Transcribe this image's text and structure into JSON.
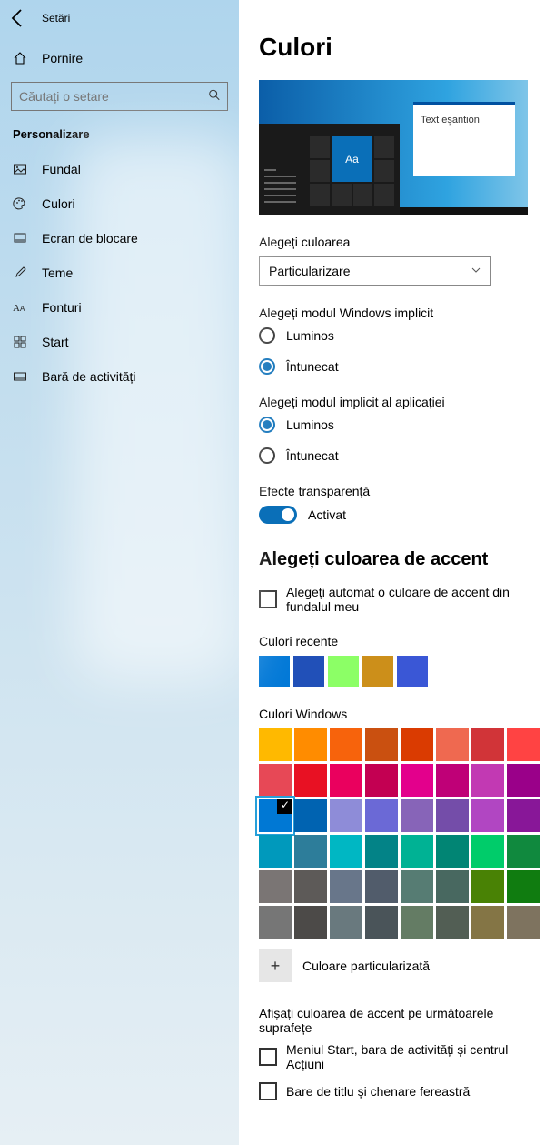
{
  "app_title": "Setări",
  "home_label": "Pornire",
  "search_placeholder": "Căutați o setare",
  "group_label": "Personalizare",
  "nav": [
    {
      "label": "Fundal"
    },
    {
      "label": "Culori"
    },
    {
      "label": "Ecran de blocare"
    },
    {
      "label": "Teme"
    },
    {
      "label": "Fonturi"
    },
    {
      "label": "Start"
    },
    {
      "label": "Bară de activități"
    }
  ],
  "page": {
    "title": "Culori",
    "preview_aa": "Aa",
    "preview_window_text": "Text eșantion",
    "choose_color_label": "Alegeți culoarea",
    "choose_color_value": "Particularizare",
    "windows_mode_label": "Alegeți modul Windows implicit",
    "mode_light": "Luminos",
    "mode_dark": "Întunecat",
    "app_mode_label": "Alegeți modul implicit al aplicației",
    "transparency_label": "Efecte transparență",
    "transparency_state": "Activat",
    "accent_heading": "Alegeți culoarea de accent",
    "auto_accent_label": "Alegeți automat o culoare de accent din fundalul meu",
    "recent_label": "Culori recente",
    "recent_colors": [
      "#0078d7",
      "#2150b8",
      "#8cff66",
      "#cc8f1a",
      "#3a57d6"
    ],
    "windows_colors_label": "Culori Windows",
    "windows_colors": [
      "#ffb900",
      "#ff8c00",
      "#f7630c",
      "#ca5010",
      "#da3b01",
      "#ef6950",
      "#d13438",
      "#ff4343",
      "#e74856",
      "#e81123",
      "#ea005e",
      "#c30052",
      "#e3008c",
      "#bf0077",
      "#c239b3",
      "#9a0089",
      "#0078d4",
      "#0063b1",
      "#8e8cd8",
      "#6b69d6",
      "#8764b8",
      "#744da9",
      "#b146c2",
      "#881798",
      "#0099bc",
      "#2d7d9a",
      "#00b7c3",
      "#038387",
      "#00b294",
      "#018574",
      "#00cc6a",
      "#10893e",
      "#7a7574",
      "#5d5a58",
      "#68768a",
      "#515c6b",
      "#567c73",
      "#486860",
      "#498205",
      "#107c10",
      "#767676",
      "#4c4a48",
      "#69797e",
      "#4a5459",
      "#647c64",
      "#525e54",
      "#847545",
      "#7e735f"
    ],
    "selected_color_index": 16,
    "custom_color_label": "Culoare particularizată",
    "surfaces_label": "Afișați culoarea de accent pe următoarele suprafețe",
    "surface_start": "Meniul Start, bara de activități și centrul Acțiuni",
    "surface_title": "Bare de titlu și chenare fereastră"
  }
}
